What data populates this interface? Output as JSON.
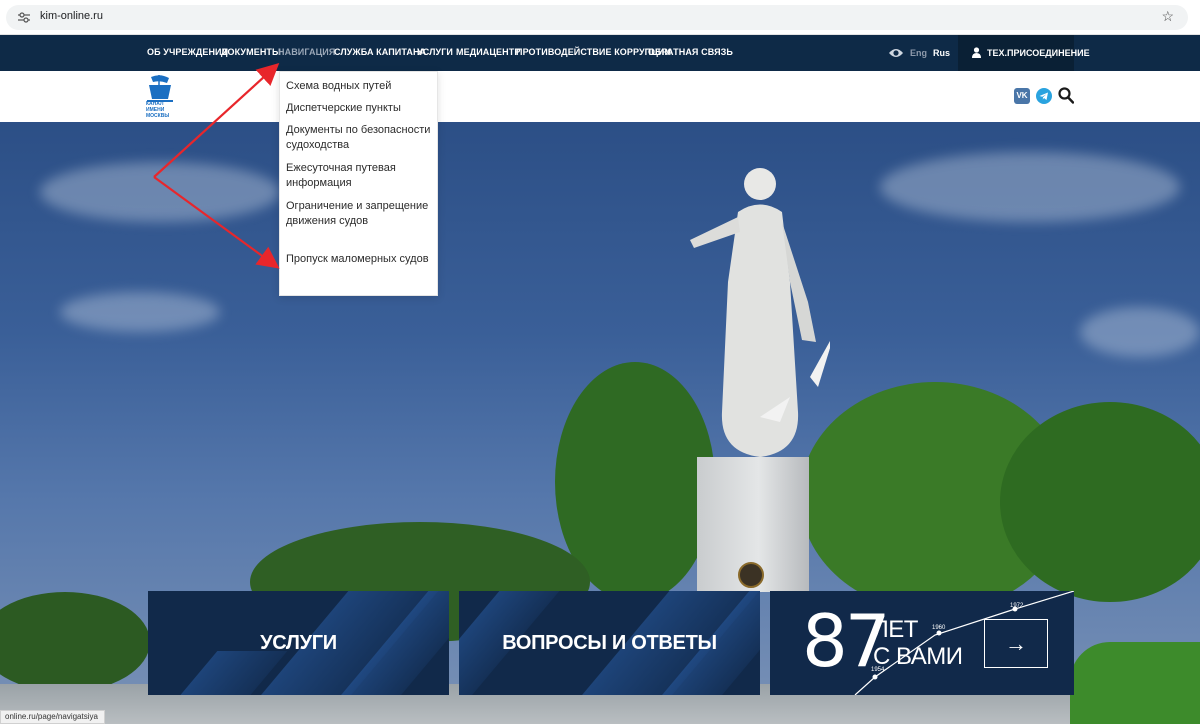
{
  "browser": {
    "url": "kim-online.ru",
    "status_url": "online.ru/page/navigatsiya",
    "icons": {
      "site_info": "tune-icon",
      "bookmark": "star-icon"
    }
  },
  "topnav": {
    "items": [
      {
        "label": "ОБ УЧРЕЖДЕНИИ",
        "active": false
      },
      {
        "label": "ДОКУМЕНТЫ",
        "active": false
      },
      {
        "label": "НАВИГАЦИЯ",
        "active": true
      },
      {
        "label": "СЛУЖБА КАПИТАНА",
        "active": false
      },
      {
        "label": "УСЛУГИ",
        "active": false
      },
      {
        "label": "МЕДИАЦЕНТР",
        "active": false
      },
      {
        "label": "ПРОТИВОДЕЙСТВИЕ КОРРУПЦИИ",
        "active": false
      },
      {
        "label": "ОБРАТНАЯ СВЯЗЬ",
        "active": false
      }
    ],
    "accessibility_icon": "eye-icon",
    "lang_en": "Eng",
    "lang_ru": "Rus",
    "connect_label": "ТЕХ.ПРИСОЕДИНЕНИЕ",
    "background": "#0e2a47",
    "active_color": "#9aa7b7"
  },
  "header": {
    "logo_text": "КАНАЛ ИМЕНИ МОСКВЫ",
    "social": {
      "vk": "VK",
      "telegram": "telegram-icon",
      "search": "search-icon"
    }
  },
  "dropdown": {
    "items": [
      "Схема водных путей",
      "Диспетчерские пункты",
      "Документы по безопасности судоходства",
      "Ежесуточная путевая информация",
      "Ограничение и запрещение движения судов",
      "Пропуск маломерных судов"
    ]
  },
  "tiles": {
    "services": "УСЛУГИ",
    "faq": "ВОПРОСЫ И ОТВЕТЫ",
    "anniversary": {
      "number": "87",
      "line1": "ЛЕТ",
      "line2": "С ВАМИ",
      "timeline_years": [
        "1954",
        "1960",
        "1972"
      ],
      "arrow": "→"
    },
    "background": "#11294a"
  },
  "annotations": {
    "arrow_color": "#e8262b"
  }
}
